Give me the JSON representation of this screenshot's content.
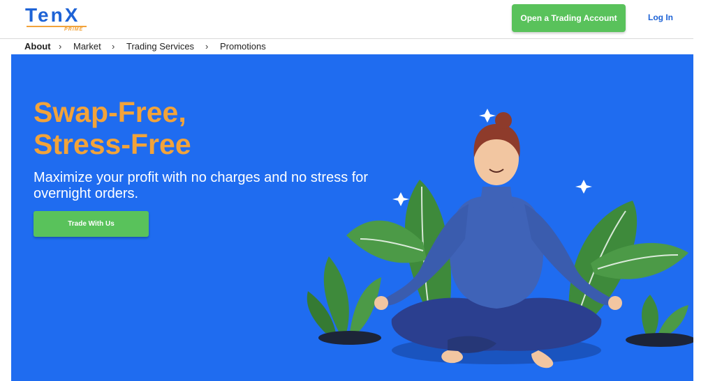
{
  "header": {
    "logo": {
      "main": "TenX",
      "sub": "PRIME"
    },
    "cta_label": "Open a Trading Account",
    "login_label": "Log In"
  },
  "breadcrumb": {
    "items": [
      "About",
      "Market",
      "Trading Services",
      "Promotions"
    ],
    "separator": "›"
  },
  "hero": {
    "title_line1": "Swap-Free,",
    "title_line2": "Stress-Free",
    "subtitle": "Maximize your profit with no charges and no stress for overnight orders.",
    "button_label": "Trade With Us",
    "colors": {
      "background": "#1f6cf0",
      "title": "#f2a33a",
      "button": "#59c25b"
    }
  },
  "illustration": {
    "subject": "meditating-woman-icon",
    "decor": [
      "leaf-icon",
      "sparkle-icon"
    ]
  }
}
